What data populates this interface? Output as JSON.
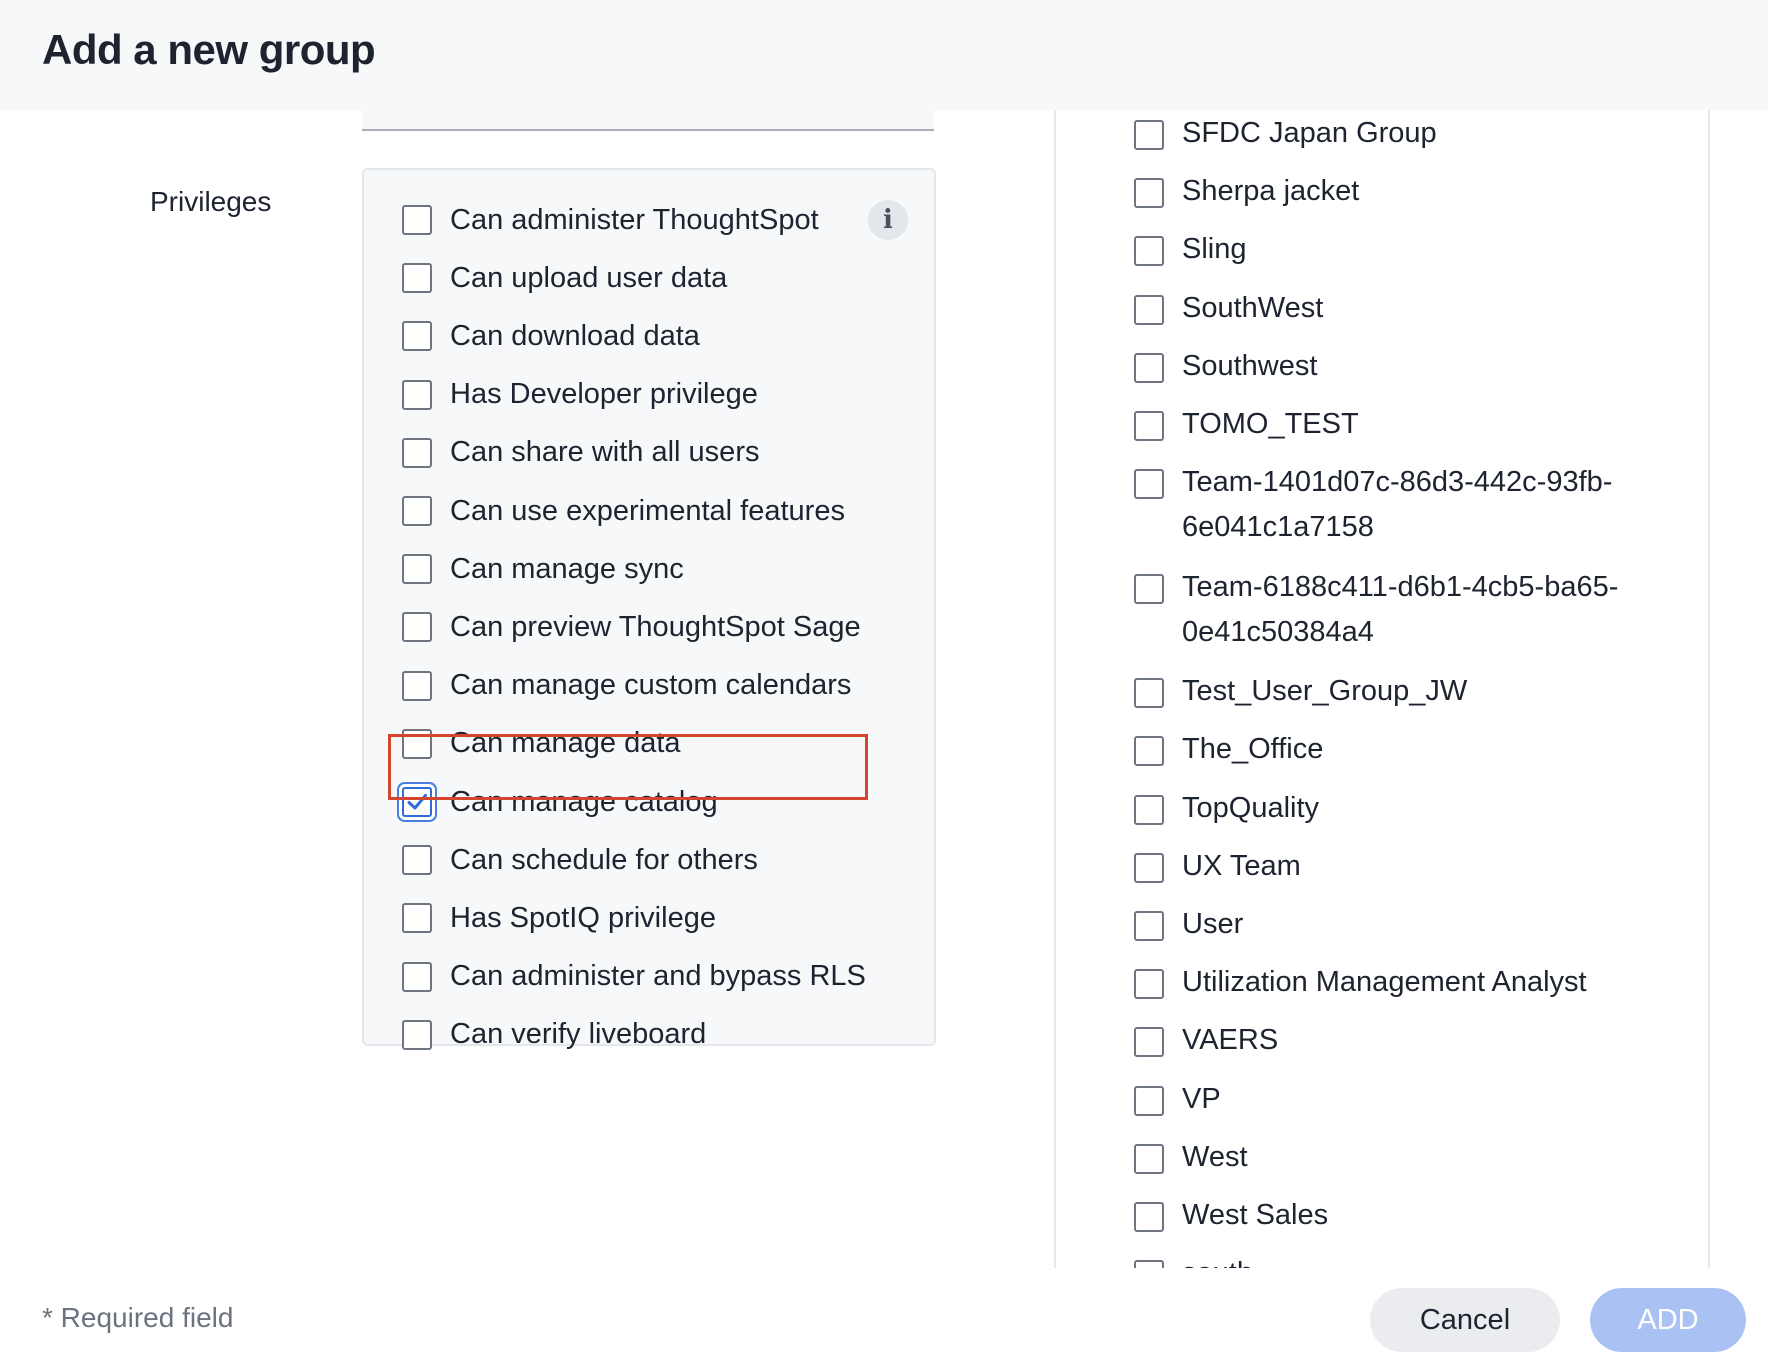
{
  "dialog": {
    "title": "Add a new group",
    "required_note": "* Required field",
    "cancel_label": "Cancel",
    "add_label": "ADD"
  },
  "privileges": {
    "label": "Privileges",
    "info_icon": "info-icon",
    "items": [
      {
        "label": "Can administer ThoughtSpot",
        "checked": false
      },
      {
        "label": "Can upload user data",
        "checked": false
      },
      {
        "label": "Can download data",
        "checked": false
      },
      {
        "label": "Has Developer privilege",
        "checked": false
      },
      {
        "label": "Can share with all users",
        "checked": false
      },
      {
        "label": "Can use experimental features",
        "checked": false
      },
      {
        "label": "Can manage sync",
        "checked": false
      },
      {
        "label": "Can preview ThoughtSpot Sage",
        "checked": false
      },
      {
        "label": "Can manage custom calendars",
        "checked": false
      },
      {
        "label": "Can manage data",
        "checked": false
      },
      {
        "label": "Can manage catalog",
        "checked": true
      },
      {
        "label": "Can schedule for others",
        "checked": false
      },
      {
        "label": "Has SpotIQ privilege",
        "checked": false
      },
      {
        "label": "Can administer and bypass RLS",
        "checked": false
      },
      {
        "label": "Can verify liveboard",
        "checked": false
      }
    ]
  },
  "groups": {
    "items": [
      {
        "label": "SFDC Japan Group",
        "checked": false
      },
      {
        "label": "Sherpa jacket",
        "checked": false
      },
      {
        "label": "Sling",
        "checked": false
      },
      {
        "label": "SouthWest",
        "checked": false
      },
      {
        "label": "Southwest",
        "checked": false
      },
      {
        "label": "TOMO_TEST",
        "checked": false
      },
      {
        "label": "Team-1401d07c-86d3-442c-93fb-6e041c1a7158",
        "checked": false
      },
      {
        "label": "Team-6188c411-d6b1-4cb5-ba65-0e41c50384a4",
        "checked": false
      },
      {
        "label": "Test_User_Group_JW",
        "checked": false
      },
      {
        "label": "The_Office",
        "checked": false
      },
      {
        "label": "TopQuality",
        "checked": false
      },
      {
        "label": "UX Team",
        "checked": false
      },
      {
        "label": "User",
        "checked": false
      },
      {
        "label": "Utilization Management Analyst",
        "checked": false
      },
      {
        "label": "VAERS",
        "checked": false
      },
      {
        "label": "VP",
        "checked": false
      },
      {
        "label": "West",
        "checked": false
      },
      {
        "label": "West Sales",
        "checked": false
      },
      {
        "label": "south",
        "checked": false
      }
    ]
  },
  "colors": {
    "accent": "#2f6adf",
    "highlight": "#d4452f",
    "add_button_bg": "#a9c2f3"
  }
}
